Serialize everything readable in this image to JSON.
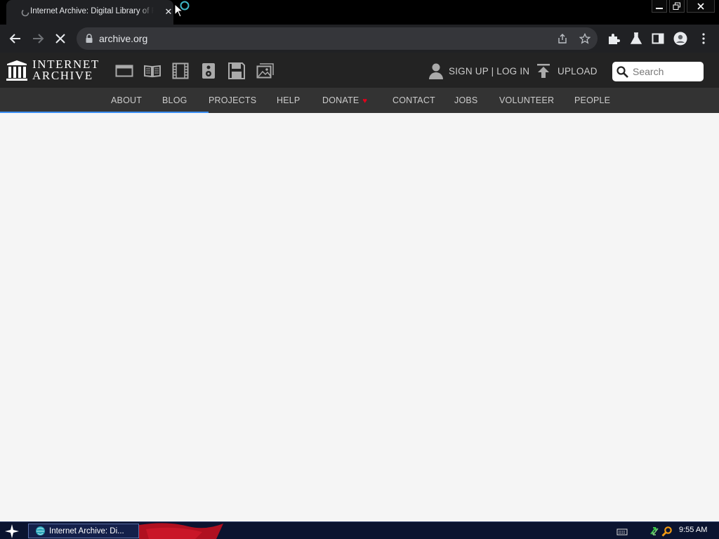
{
  "browser": {
    "tab_title": "Internet Archive: Digital Library of Free",
    "url": "archive.org"
  },
  "ia_header": {
    "logo_line1": "INTERNET",
    "logo_line2": "ARCHIVE",
    "media_icons": [
      "web-icon",
      "texts-icon",
      "video-icon",
      "audio-icon",
      "software-icon",
      "images-icon"
    ],
    "sign_up_log_in": "SIGN UP | LOG IN",
    "upload": "UPLOAD",
    "search_placeholder": "Search"
  },
  "nav": {
    "items": [
      "ABOUT",
      "BLOG",
      "PROJECTS",
      "HELP",
      "DONATE",
      "CONTACT",
      "JOBS",
      "VOLUNTEER",
      "PEOPLE"
    ],
    "donate_heart": "♥"
  },
  "page_load_progress": 0.29,
  "taskbar": {
    "task_label": "Internet Archive: Di...",
    "clock": "9:55 AM"
  },
  "colors": {
    "ia_header_bg": "#232323",
    "ia_nav_bg": "#333333",
    "progress": "#3b8ff3",
    "heart": "#e3001b"
  }
}
